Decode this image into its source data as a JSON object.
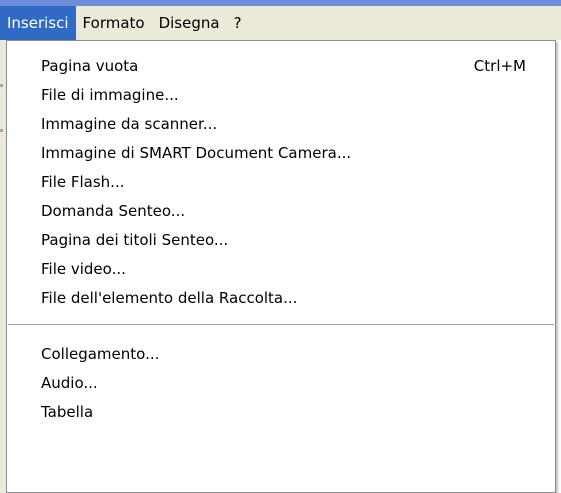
{
  "menubar": {
    "items": [
      {
        "label": "Inserisci",
        "active": true
      },
      {
        "label": "Formato"
      },
      {
        "label": "Disegna"
      },
      {
        "label": "?"
      }
    ]
  },
  "dropdown": {
    "group1": [
      {
        "label": "Pagina vuota",
        "shortcut": "Ctrl+M"
      },
      {
        "label": "File di immagine..."
      },
      {
        "label": "Immagine da scanner..."
      },
      {
        "label": "Immagine di SMART Document Camera..."
      },
      {
        "label": "File Flash..."
      },
      {
        "label": "Domanda Senteo..."
      },
      {
        "label": "Pagina dei titoli Senteo..."
      },
      {
        "label": "File video..."
      },
      {
        "label": "File dell'elemento della Raccolta..."
      }
    ],
    "group2": [
      {
        "label": "Collegamento..."
      },
      {
        "label": "Audio..."
      },
      {
        "label": "Tabella"
      }
    ]
  },
  "colors": {
    "highlight": "#316ac5",
    "menubar_bg": "#ece9d8",
    "title_blue": "#6e8fd8"
  }
}
